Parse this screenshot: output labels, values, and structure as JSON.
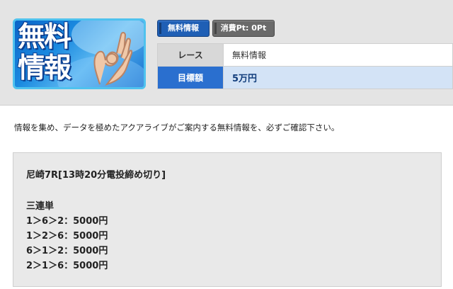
{
  "hero": {
    "title": "無料情報",
    "hand_icon": "ok-hand-icon"
  },
  "badges": {
    "free_label": "無料情報",
    "points_label": "消費Pt: 0Pt"
  },
  "info_table": {
    "race_label": "レース",
    "race_value": "無料情報",
    "target_label": "目標額",
    "target_value": "5万円"
  },
  "intro_text": "情報を集め、データを極めたアクアライブがご案内する無料情報を、必ずご確認下さい。",
  "pick": {
    "title": "尼崎7R[13時20分電投締め切り]",
    "bet_type": "三連単",
    "combos": [
      "1＞6＞2：5000円",
      "1＞2＞6：5000円",
      "6＞1＞2：5000円",
      "2＞1＞6：5000円"
    ]
  },
  "colors": {
    "header_bg": "#e4e4e4",
    "accent_blue": "#2a6fcf",
    "highlight_row": "#d3e3f6",
    "points_badge": "#6a6a6a"
  }
}
